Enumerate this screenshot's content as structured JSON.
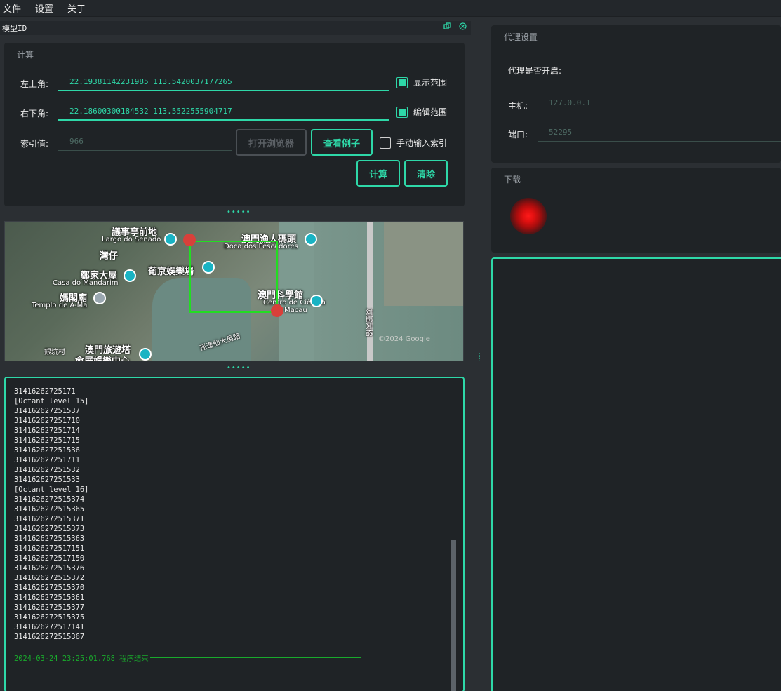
{
  "menu": [
    "文件",
    "设置",
    "关于"
  ],
  "dock": {
    "title": "模型ID",
    "float_icon": "float-icon",
    "close_icon": "close-icon"
  },
  "calc": {
    "group_title": "计算",
    "top_left_label": "左上角:",
    "top_left_value": "22.19381142231985 113.5420037177265",
    "bottom_right_label": "右下角:",
    "bottom_right_value": "22.18600300184532 113.5522555904717",
    "index_label": "索引值:",
    "index_placeholder": "966",
    "show_range_label": "显示范围",
    "show_range_checked": true,
    "edit_range_label": "编辑范围",
    "edit_range_checked": true,
    "manual_index_label": "手动输入索引",
    "manual_index_checked": false,
    "open_browser_label": "打开浏览器",
    "view_example_label": "查看例子",
    "compute_label": "计算",
    "clear_label": "清除"
  },
  "map": {
    "labels": {
      "senado_cn": "議事亭前地",
      "senado_pt": "Largo do Senado",
      "pescadores_cn": "澳門漁人碼頭",
      "pescadores_pt": "Doca dos Pescadores",
      "wanzai": "灣仔",
      "mandarim_cn": "鄭家大屋",
      "mandarim_pt": "Casa do Mandarim",
      "lisboa": "葡京娛樂場",
      "amah_cn": "媽閣廟",
      "amah_pt": "Templo de A-Ma",
      "science_cn": "澳門科學館",
      "science_pt1": "Centro de Ciência",
      "science_pt2": "Macau",
      "sunyatsen": "孫逸仙大馬路",
      "bridge": "友誼大橋",
      "watermark": "©2024 Google",
      "village": "銀坑村",
      "tourism1": "澳門旅遊塔",
      "tourism2": "會展娛樂中心"
    }
  },
  "log": {
    "lines": [
      "31416262725171",
      "[Octant level 15]",
      "314162627251537",
      "314162627251710",
      "314162627251714",
      "314162627251715",
      "314162627251536",
      "314162627251711",
      "314162627251532",
      "314162627251533",
      "[Octant level 16]",
      "3141626272515374",
      "3141626272515365",
      "3141626272515371",
      "3141626272515373",
      "3141626272515363",
      "3141626272517151",
      "3141626272517150",
      "3141626272515376",
      "3141626272515372",
      "3141626272515370",
      "3141626272515361",
      "3141626272515377",
      "3141626272515375",
      "3141626272517141",
      "3141626272515367"
    ],
    "end_message": "2024-03-24 23:25:01.768 程序结束"
  },
  "proxy": {
    "group_title": "代理设置",
    "enabled_label": "代理是否开启:",
    "host_label": "主机:",
    "host_placeholder": "127.0.0.1",
    "port_label": "端口:",
    "port_placeholder": "52295"
  },
  "download": {
    "group_title": "下载",
    "status_color": "#ff1a1a"
  },
  "colors": {
    "accent": "#2ed8a8",
    "background": "#2b2f33",
    "panel": "#1f2326"
  }
}
